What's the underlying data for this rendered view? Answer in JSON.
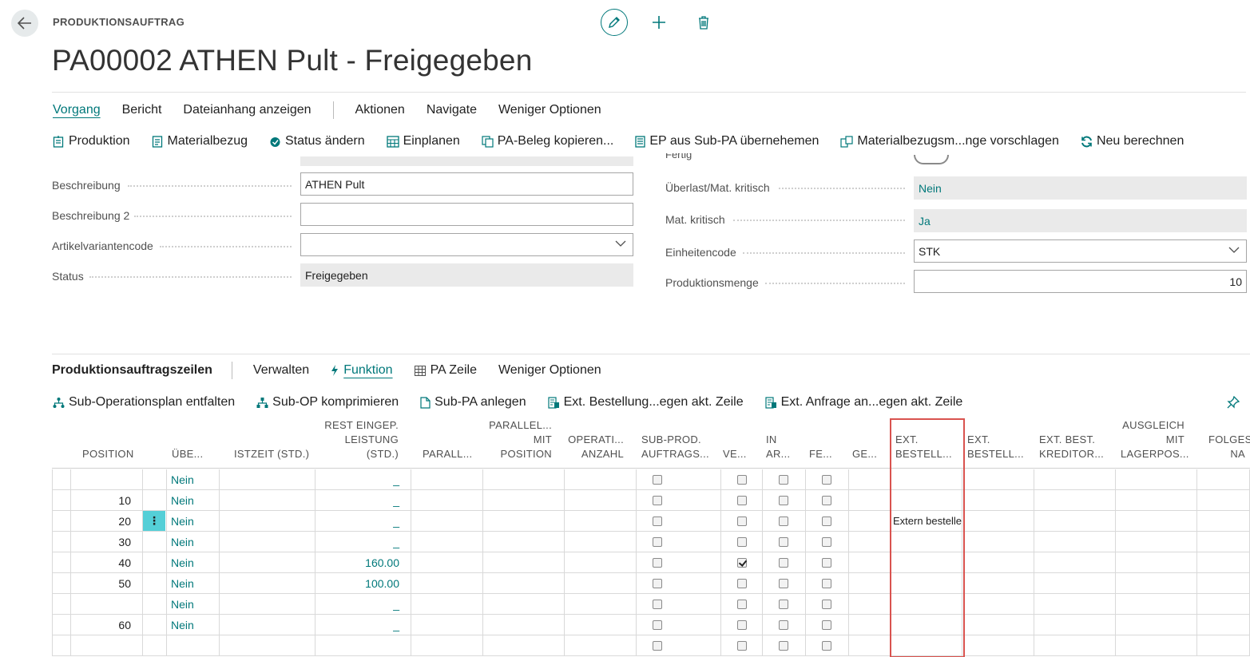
{
  "header": {
    "caption": "PRODUKTIONSAUFTRAG",
    "title": "PA00002 ATHEN Pult - Freigegeben"
  },
  "menu": {
    "items": [
      "Vorgang",
      "Bericht",
      "Dateianhang anzeigen",
      "Aktionen",
      "Navigate",
      "Weniger Optionen"
    ]
  },
  "actions": {
    "items": [
      "Produktion",
      "Materialbezug",
      "Status ändern",
      "Einplanen",
      "PA-Beleg kopieren...",
      "EP aus Sub-PA übernehemen",
      "Materialbezugsm...nge vorschlagen",
      "Neu berechnen"
    ]
  },
  "form": {
    "left": [
      {
        "label": "Beschreibung",
        "value": "ATHEN Pult"
      },
      {
        "label": "Beschreibung 2",
        "value": ""
      },
      {
        "label": "Artikelvariantencode",
        "value": ""
      },
      {
        "label": "Status",
        "value": "Freigegeben"
      }
    ],
    "right": [
      {
        "label": "Überlast/Mat. kritisch",
        "value": "Nein"
      },
      {
        "label": "Mat. kritisch",
        "value": "Ja"
      },
      {
        "label": "Einheitencode",
        "value": "STK"
      },
      {
        "label": "Produktionsmenge",
        "value": "10"
      }
    ],
    "cut_label_right": "Fertig"
  },
  "subpage": {
    "title": "Produktionsauftragszeilen",
    "menu": [
      "Verwalten",
      "Funktion",
      "PA Zeile",
      "Weniger Optionen"
    ],
    "actions": [
      "Sub-Operationsplan entfalten",
      "Sub-OP komprimieren",
      "Sub-PA anlegen",
      "Ext. Bestellung...egen akt. Zeile",
      "Ext. Anfrage an...egen akt. Zeile"
    ]
  },
  "grid": {
    "headers": {
      "position": "POSITION",
      "ueber": "ÜBE...",
      "istzeit": "ISTZEIT (STD.)",
      "rest_1": "REST EINGEP.",
      "rest_2": "LEISTUNG",
      "rest_3": "(STD.)",
      "parall": "PARALL...",
      "pmp_1": "PARALLEL...",
      "pmp_2": "MIT",
      "pmp_3": "POSITION",
      "oper_1": "OPERATI...",
      "oper_2": "ANZAHL",
      "sub_1": "SUB-PROD.",
      "sub_2": "AUFTRAGS...",
      "ve": "VE...",
      "inar_1": "IN",
      "inar_2": "AR...",
      "fe": "FE...",
      "ge": "GE...",
      "eb1_1": "EXT.",
      "eb1_2": "BESTELL...",
      "eb2_1": "EXT.",
      "eb2_2": "BESTELL...",
      "ebk_1": "EXT. BEST.",
      "ebk_2": "KREDITOR...",
      "aus_1": "AUSGLEICH",
      "aus_2": "MIT",
      "aus_3": "LAGERPOS...",
      "fol_1": "FOLGES",
      "fol_2": "NA"
    },
    "rows": [
      {
        "position": "",
        "ueber": "Nein",
        "rest": "_",
        "ext": "",
        "in_ar": false
      },
      {
        "position": "10",
        "ueber": "Nein",
        "rest": "_",
        "ext": "",
        "in_ar": false
      },
      {
        "position": "20",
        "ueber": "Nein",
        "rest": "_",
        "ext": "Extern bestellen",
        "in_ar": false
      },
      {
        "position": "30",
        "ueber": "Nein",
        "rest": "_",
        "ext": "",
        "in_ar": false
      },
      {
        "position": "40",
        "ueber": "Nein",
        "rest": "160.00",
        "ext": "",
        "in_ar": true
      },
      {
        "position": "50",
        "ueber": "Nein",
        "rest": "100.00",
        "ext": "",
        "in_ar": false
      },
      {
        "position": "",
        "ueber": "Nein",
        "rest": "_",
        "ext": "",
        "in_ar": false
      },
      {
        "position": "60",
        "ueber": "Nein",
        "rest": "_",
        "ext": "",
        "in_ar": false
      },
      {
        "position": "",
        "ueber": "",
        "rest": "",
        "ext": "",
        "in_ar": false
      }
    ],
    "row_menu_glyph": "⋮"
  }
}
